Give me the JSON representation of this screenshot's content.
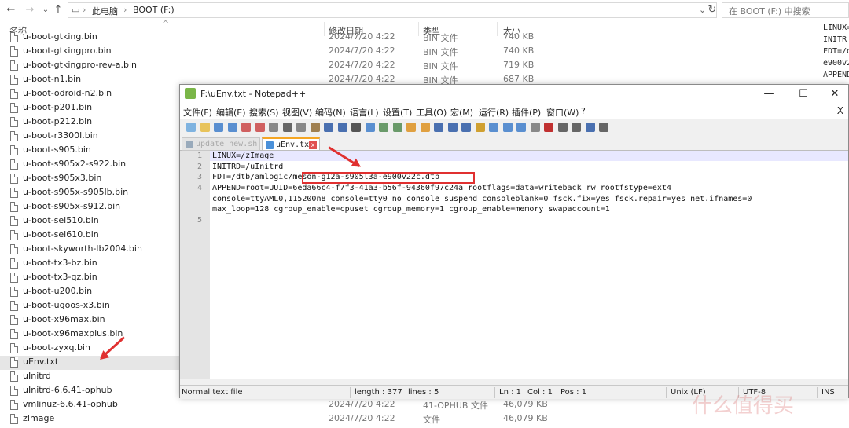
{
  "explorer": {
    "path_parts": [
      "此电脑",
      "BOOT (F:)"
    ],
    "search_placeholder": "在 BOOT (F:) 中搜索",
    "columns": {
      "name": "名称",
      "date": "修改日期",
      "type": "类型",
      "size": "大小"
    },
    "files": [
      {
        "name": "u-boot-gtking.bin",
        "date": "2024/7/20 4:22",
        "type": "BIN 文件",
        "size": "740 KB"
      },
      {
        "name": "u-boot-gtkingpro.bin",
        "date": "2024/7/20 4:22",
        "type": "BIN 文件",
        "size": "740 KB"
      },
      {
        "name": "u-boot-gtkingpro-rev-a.bin",
        "date": "2024/7/20 4:22",
        "type": "BIN 文件",
        "size": "719 KB"
      },
      {
        "name": "u-boot-n1.bin",
        "date": "2024/7/20 4:22",
        "type": "BIN 文件",
        "size": "687 KB"
      },
      {
        "name": "u-boot-odroid-n2.bin"
      },
      {
        "name": "u-boot-p201.bin"
      },
      {
        "name": "u-boot-p212.bin"
      },
      {
        "name": "u-boot-r3300l.bin"
      },
      {
        "name": "u-boot-s905.bin"
      },
      {
        "name": "u-boot-s905x2-s922.bin"
      },
      {
        "name": "u-boot-s905x3.bin"
      },
      {
        "name": "u-boot-s905x-s905lb.bin"
      },
      {
        "name": "u-boot-s905x-s912.bin"
      },
      {
        "name": "u-boot-sei510.bin"
      },
      {
        "name": "u-boot-sei610.bin"
      },
      {
        "name": "u-boot-skyworth-lb2004.bin"
      },
      {
        "name": "u-boot-tx3-bz.bin"
      },
      {
        "name": "u-boot-tx3-qz.bin"
      },
      {
        "name": "u-boot-u200.bin"
      },
      {
        "name": "u-boot-ugoos-x3.bin"
      },
      {
        "name": "u-boot-x96max.bin"
      },
      {
        "name": "u-boot-x96maxplus.bin"
      },
      {
        "name": "u-boot-zyxq.bin"
      },
      {
        "name": "uEnv.txt",
        "selected": true
      },
      {
        "name": "uInitrd"
      },
      {
        "name": "uInitrd-6.6.41-ophub"
      },
      {
        "name": "vmlinuz-6.6.41-ophub",
        "date": "2024/7/20 4:22",
        "type": "41-OPHUB 文件",
        "size": "46,079 KB"
      },
      {
        "name": "zImage",
        "date": "2024/7/20 4:22",
        "type": "文件",
        "size": "46,079 KB"
      }
    ],
    "preview_lines": [
      "LINUX=",
      "INITR",
      "FDT=/d",
      "e900v2",
      "APPEND"
    ]
  },
  "notepad": {
    "title": "F:\\uEnv.txt - Notepad++",
    "menus": [
      "文件(F)",
      "编辑(E)",
      "搜索(S)",
      "视图(V)",
      "编码(N)",
      "语言(L)",
      "设置(T)",
      "工具(O)",
      "宏(M)",
      "运行(R)",
      "插件(P)",
      "窗口(W)",
      "?"
    ],
    "close_doc": "X",
    "tabs": [
      "update_new.sh",
      "uEnv.txt"
    ],
    "line_numbers": [
      "1",
      "2",
      "3",
      "4",
      "",
      "",
      "5"
    ],
    "lines": [
      "LINUX=/zImage",
      "INITRD=/uInitrd",
      "FDT=/dtb/amlogic/meson-g12a-s905l3a-e900v22c.dtb",
      "APPEND=root=UUID=6eda66c4-f7f3-41a3-b56f-94360f97c24a rootflags=data=writeback rw rootfstype=ext4",
      "console=ttyAML0,115200n8 console=tty0 no_console_suspend consoleblank=0 fsck.fix=yes fsck.repair=yes net.ifnames=0",
      "max_loop=128 cgroup_enable=cpuset cgroup_memory=1 cgroup_enable=memory swapaccount=1"
    ],
    "status": {
      "type": "Normal text file",
      "length": "length : 377",
      "lines": "lines : 5",
      "ln": "Ln : 1",
      "col": "Col : 1",
      "pos": "Pos : 1",
      "eol": "Unix (LF)",
      "encoding": "UTF-8",
      "mode": "INS"
    }
  },
  "watermark": "什么值得买",
  "colors": {
    "accent_red": "#e03030",
    "tab_accent": "#f5a623"
  }
}
